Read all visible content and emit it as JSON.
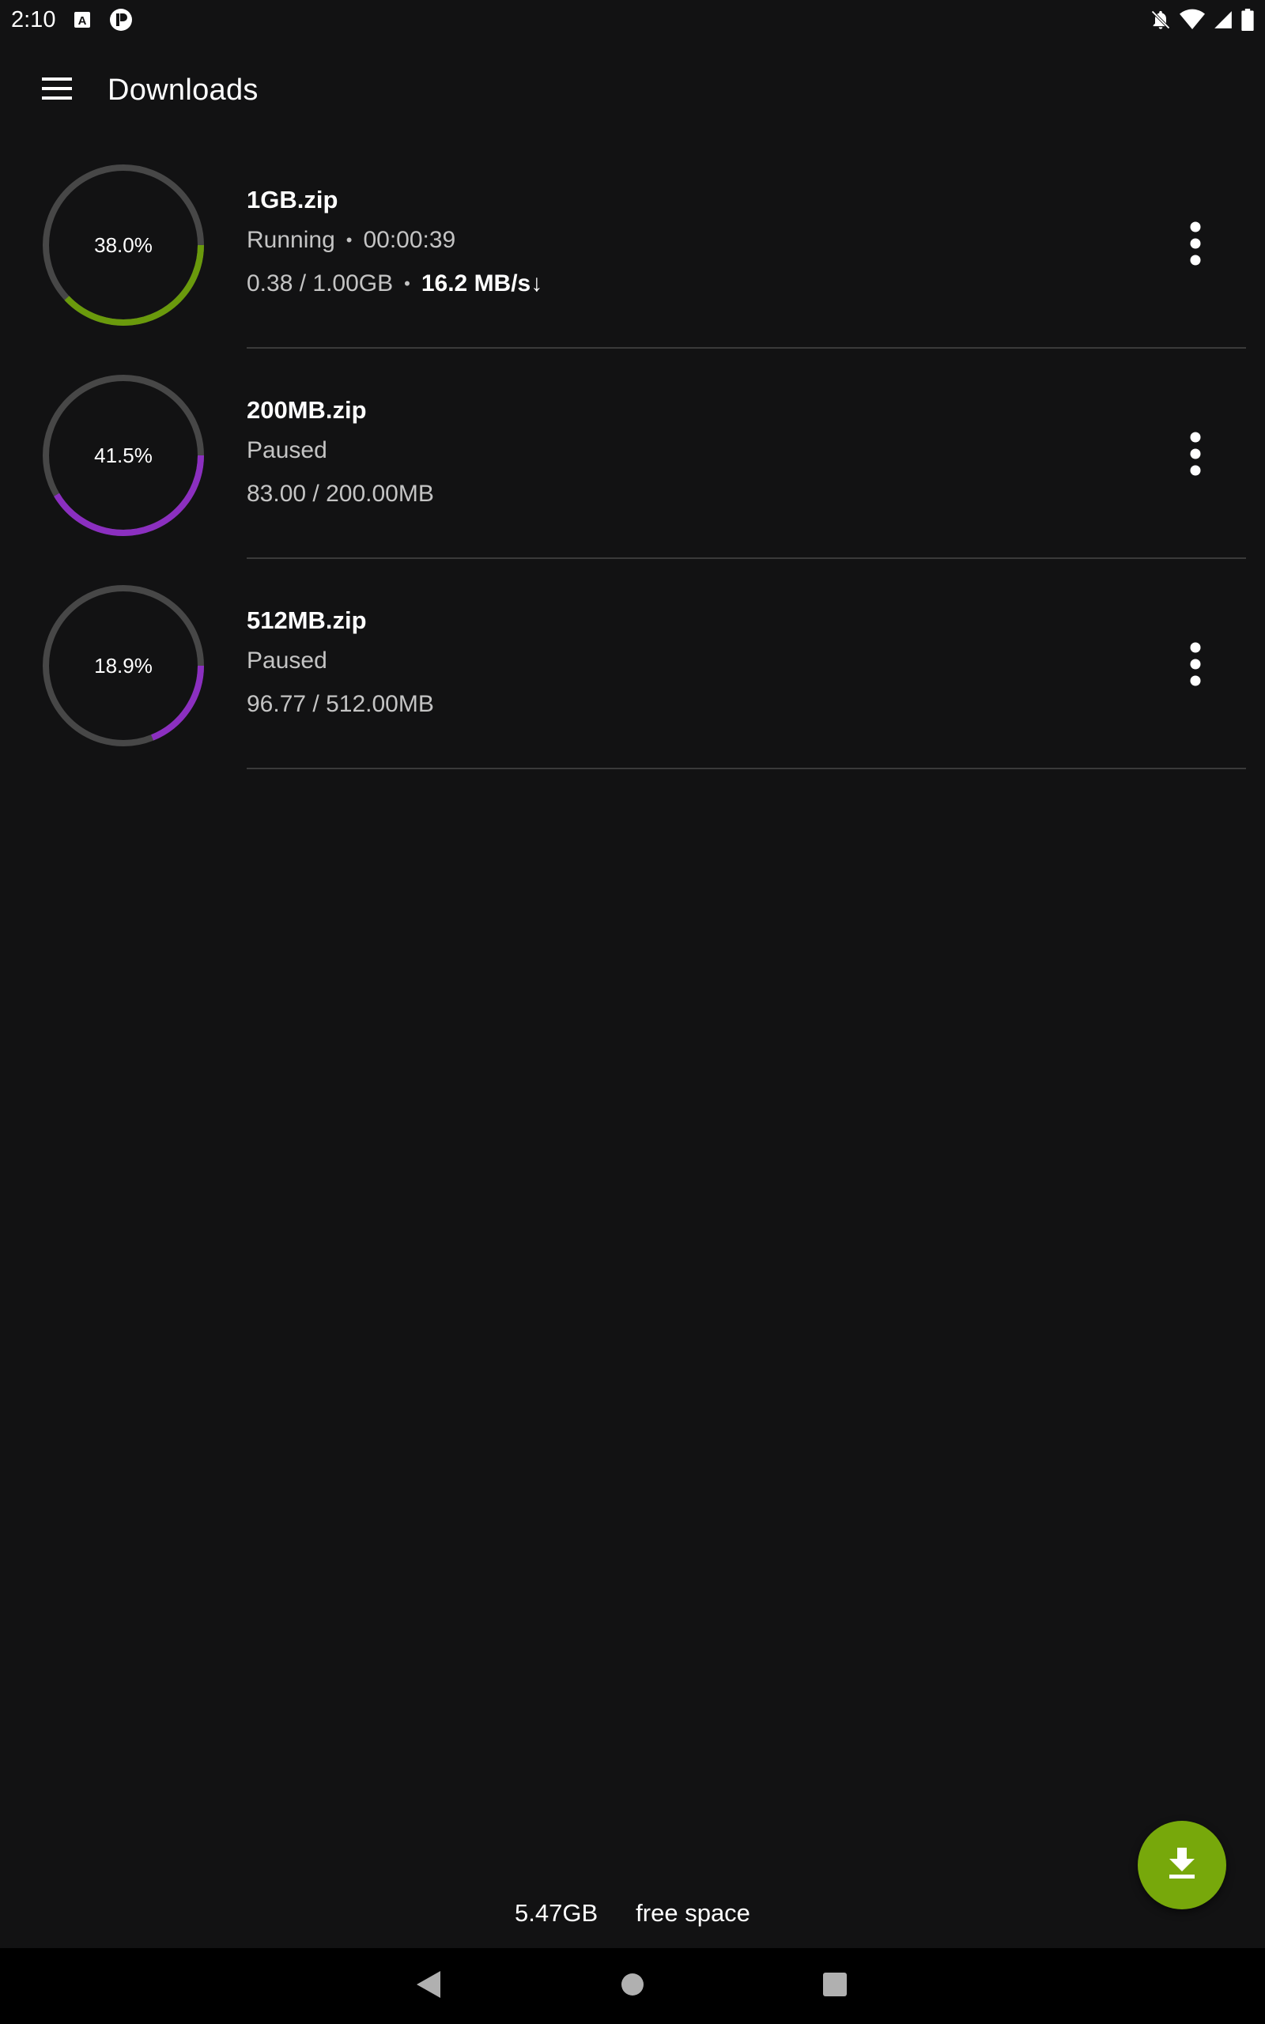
{
  "status_bar": {
    "time": "2:10",
    "left_icons": [
      "text-a-icon",
      "app-circle-icon"
    ],
    "right_icons": [
      "bell-off-icon",
      "wifi-icon",
      "signal-icon",
      "battery-icon"
    ]
  },
  "app_bar": {
    "title": "Downloads",
    "menu_icon": "hamburger-menu-icon"
  },
  "downloads": [
    {
      "file_name": "1GB.zip",
      "progress_label": "38.0%",
      "progress": 0.38,
      "progress_color": "#6a9a0c",
      "status": "Running",
      "elapsed": "00:00:39",
      "size": "0.38 / 1.00GB",
      "speed": "16.2 MB/s↓"
    },
    {
      "file_name": "200MB.zip",
      "progress_label": "41.5%",
      "progress": 0.415,
      "progress_color": "#8b2fc0",
      "status": "Paused",
      "size": "83.00 / 200.00MB"
    },
    {
      "file_name": "512MB.zip",
      "progress_label": "18.9%",
      "progress": 0.189,
      "progress_color": "#8b2fc0",
      "status": "Paused",
      "size": "96.77 / 512.00MB"
    }
  ],
  "footer": {
    "free_space_value": "5.47GB",
    "free_space_label": "free space"
  },
  "fab": {
    "icon": "download-icon",
    "color": "#77a80b"
  },
  "colors": {
    "background": "#121213",
    "track": "#474747",
    "divider": "#3a3a3a",
    "running": "#6a9a0c",
    "paused": "#8b2fc0"
  },
  "nav": {
    "icons": [
      "back-icon",
      "home-icon",
      "recents-icon"
    ]
  }
}
